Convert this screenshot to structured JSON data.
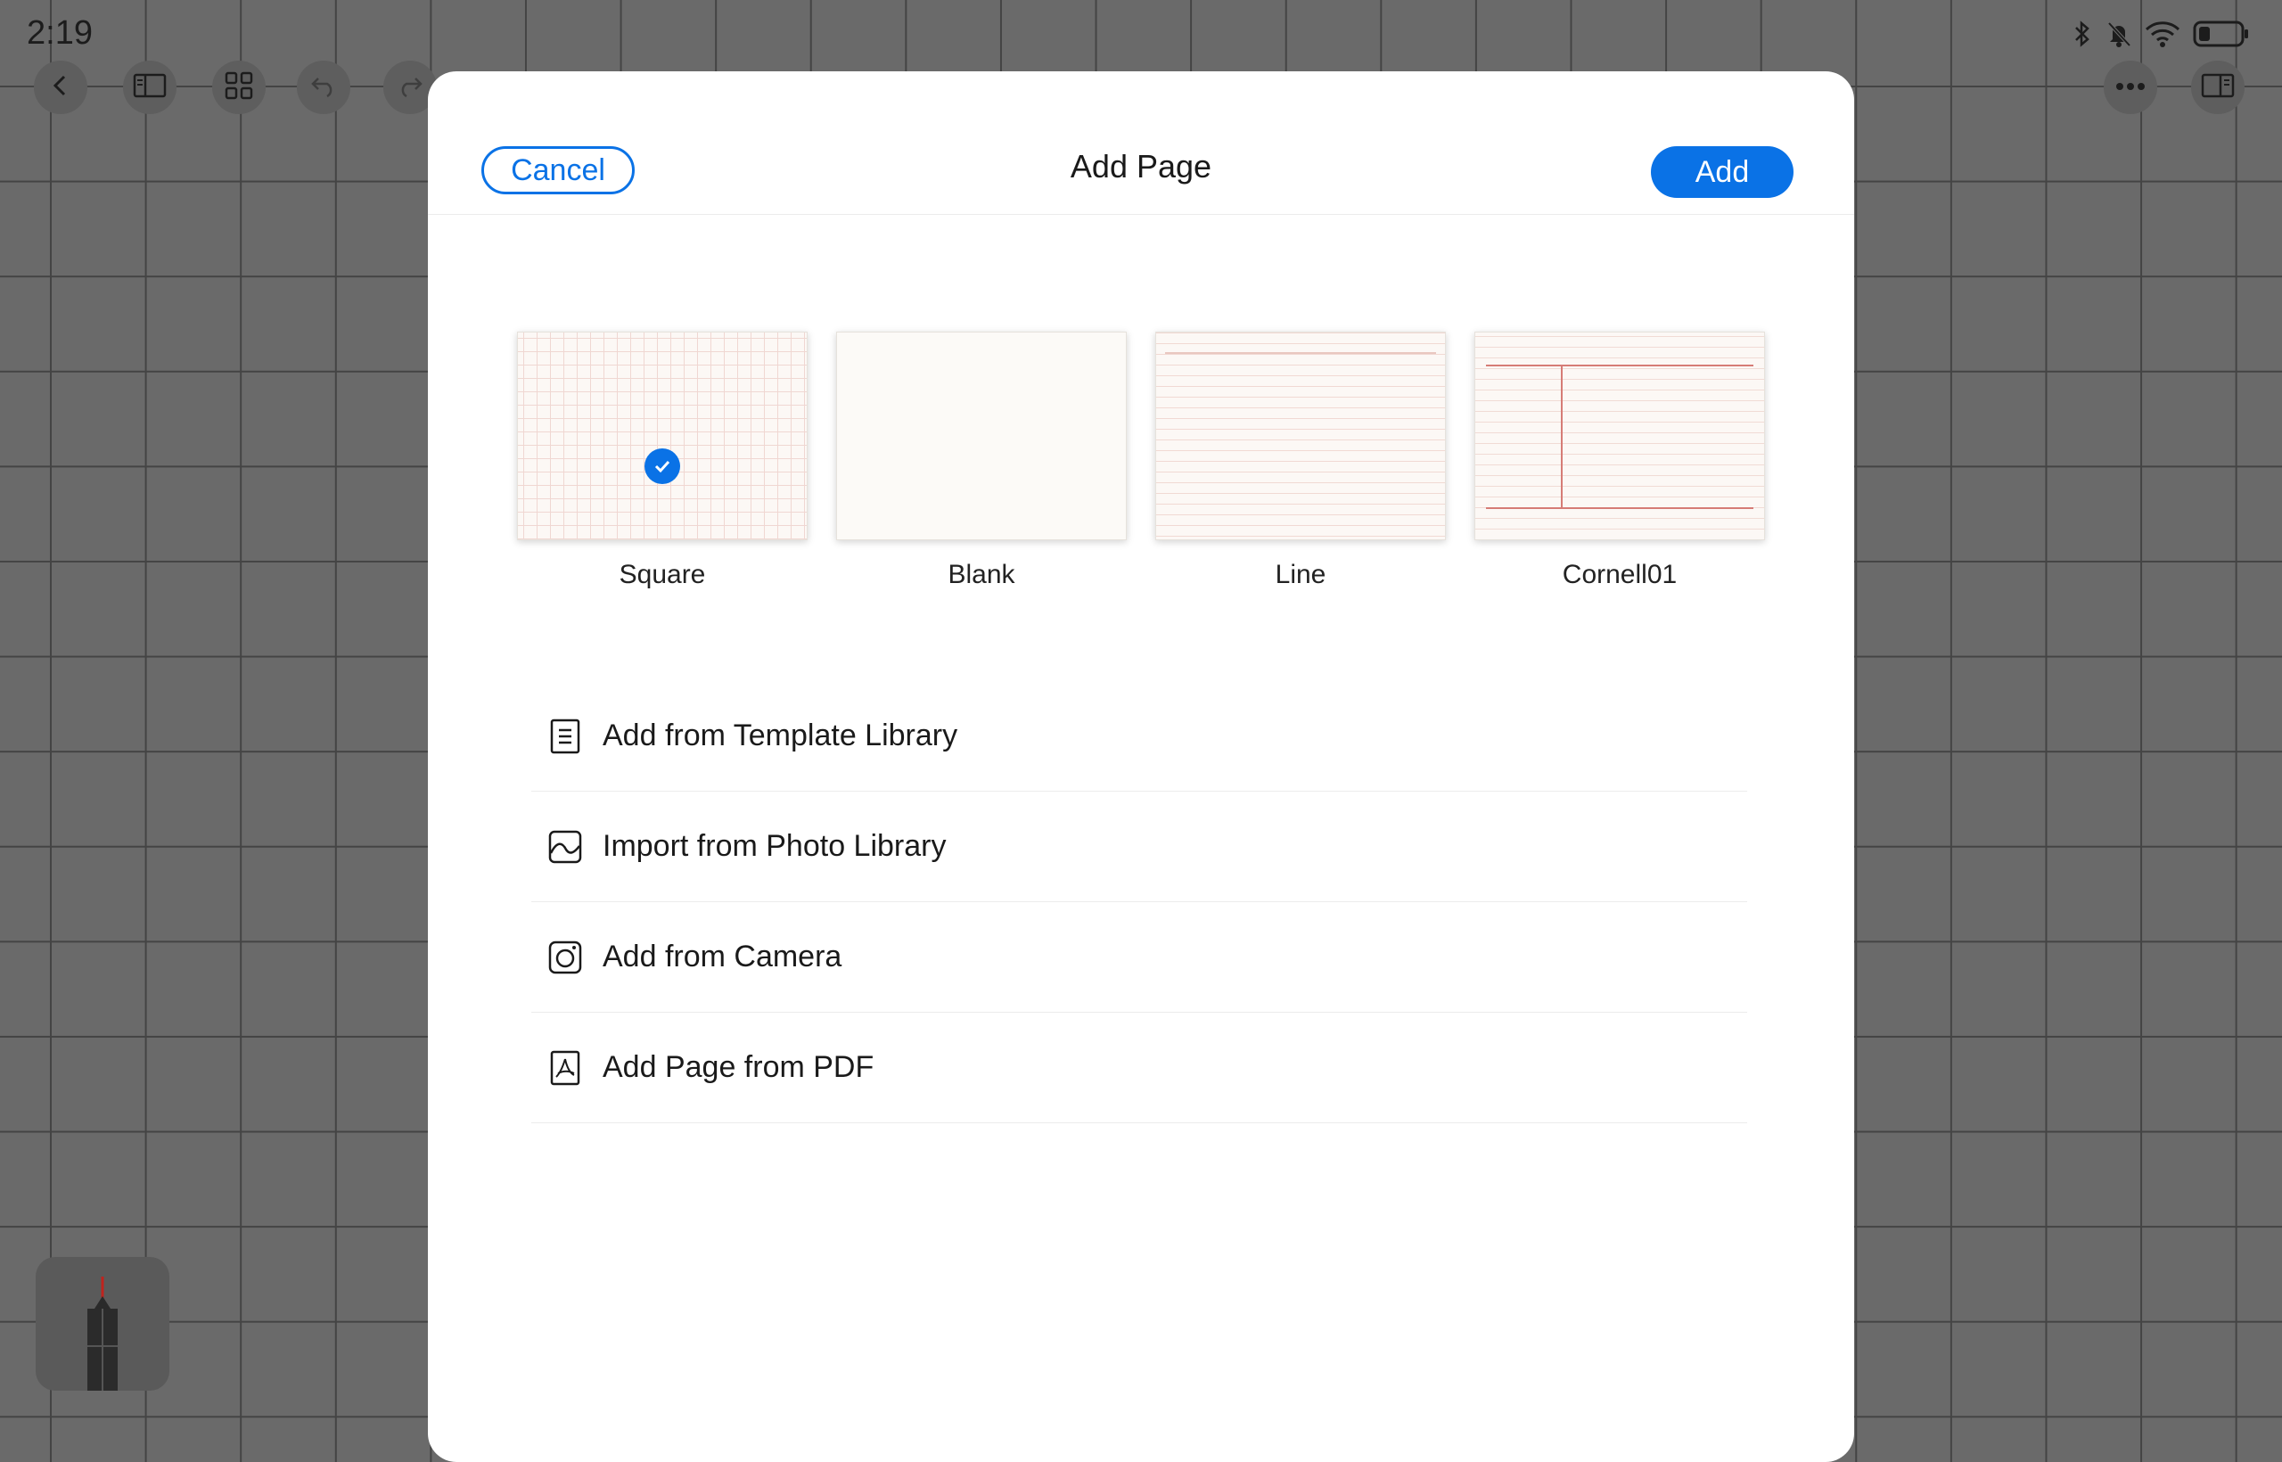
{
  "status_bar": {
    "time": "2:19",
    "icons": [
      "bluetooth-icon",
      "bell-muted-icon",
      "wifi-icon",
      "battery-icon"
    ]
  },
  "toolbar": {
    "left_icons": [
      "back-icon",
      "sidebar-icon",
      "grid-view-icon",
      "undo-icon",
      "redo-icon"
    ],
    "right_icons": [
      "more-icon",
      "split-view-icon"
    ]
  },
  "dialog": {
    "title": "Add Page",
    "cancel_label": "Cancel",
    "add_label": "Add",
    "templates": [
      {
        "label": "Square",
        "selected": true
      },
      {
        "label": "Blank",
        "selected": false
      },
      {
        "label": "Line",
        "selected": false
      },
      {
        "label": "Cornell01",
        "selected": false
      }
    ],
    "options": [
      {
        "label": "Add from Template Library",
        "icon": "template-library-icon"
      },
      {
        "label": "Import from Photo Library",
        "icon": "photo-icon"
      },
      {
        "label": "Add from Camera",
        "icon": "camera-icon"
      },
      {
        "label": "Add Page from PDF",
        "icon": "pdf-icon"
      }
    ]
  },
  "colors": {
    "accent": "#0a72e6",
    "backdrop": "#6a6a6a",
    "cornell_rule": "#d67c76"
  }
}
